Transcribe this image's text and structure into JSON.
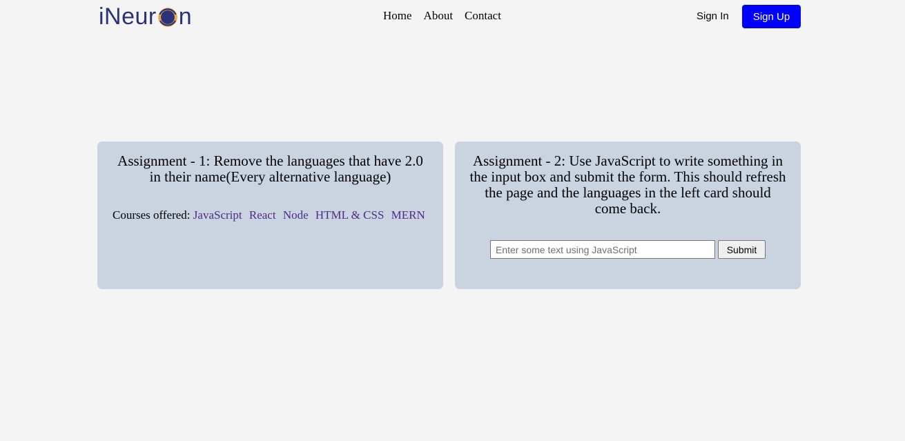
{
  "header": {
    "logo": {
      "text_before": "iNeur",
      "text_after": "n",
      "mark_icon": "ineuron-o-logo-mark",
      "colors": {
        "text": "#2b3276",
        "ring": "#f2a33a",
        "center": "#2b3276"
      }
    },
    "nav": {
      "items": [
        {
          "label": "Home"
        },
        {
          "label": "About"
        },
        {
          "label": "Contact"
        }
      ]
    },
    "signin_label": "Sign In",
    "signup_label": "Sign Up",
    "signup_color": "#0000ff"
  },
  "cards": {
    "card_bg": "#c9d4e0",
    "assignment1": {
      "title": "Assignment - 1: Remove the languages that have 2.0 in their name(Every alternative language)",
      "courses_label": "Courses offered:",
      "courses": [
        "JavaScript",
        "React",
        "Node",
        "HTML & CSS",
        "MERN"
      ],
      "link_color": "#4b2c8a"
    },
    "assignment2": {
      "title": "Assignment - 2: Use JavaScript to write something in the input box and submit the form. This should refresh the page and the languages in the left card should come back.",
      "input": {
        "value": "",
        "placeholder": "Enter some text using JavaScript"
      },
      "submit_label": "Submit"
    }
  }
}
